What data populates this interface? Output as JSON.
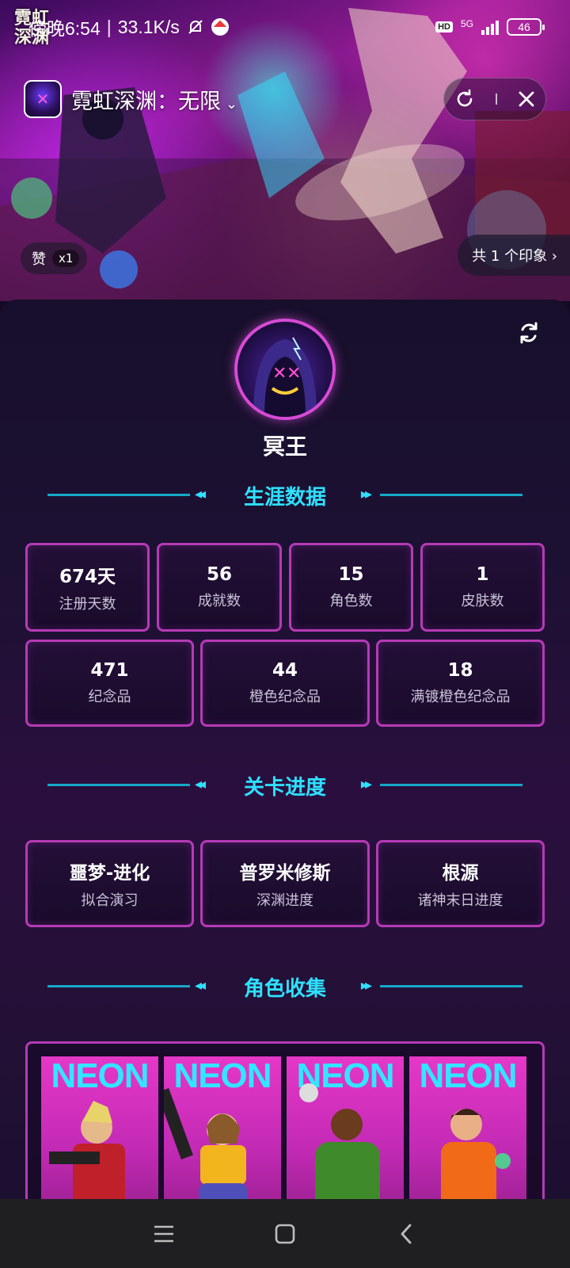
{
  "status_bar": {
    "time": "傍晚6:54",
    "net_speed": "33.1K/s",
    "hd": "HD",
    "network": "5G",
    "battery": "46"
  },
  "mini_program": {
    "title": "霓虹深渊：无限",
    "chevron": "⌄"
  },
  "banner": {
    "logo_top": "霓虹",
    "logo_bottom": "深渊",
    "like_label": "赞",
    "like_count": "x1",
    "impressions": "共 1 个印象 ›"
  },
  "profile": {
    "username": "冥王"
  },
  "sections": {
    "career": "生涯数据",
    "progress": "关卡进度",
    "collection": "角色收集"
  },
  "career_stats_row1": [
    {
      "value": "674天",
      "label": "注册天数"
    },
    {
      "value": "56",
      "label": "成就数"
    },
    {
      "value": "15",
      "label": "角色数"
    },
    {
      "value": "1",
      "label": "皮肤数"
    }
  ],
  "career_stats_row2": [
    {
      "value": "471",
      "label": "纪念品"
    },
    {
      "value": "44",
      "label": "橙色纪念品"
    },
    {
      "value": "18",
      "label": "满镀橙色纪念品"
    }
  ],
  "level_progress": [
    {
      "value": "噩梦-进化",
      "label": "拟合演习"
    },
    {
      "value": "普罗米修斯",
      "label": "深渊进度"
    },
    {
      "value": "根源",
      "label": "诸神末日进度"
    }
  ],
  "characters": [
    {
      "badge": "NEON",
      "shirt": "#c0202a",
      "skin": "#e6b98a"
    },
    {
      "badge": "NEON",
      "shirt": "#f2b51e",
      "skin": "#f0c8a0"
    },
    {
      "badge": "NEON",
      "shirt": "#3f8a2a",
      "skin": "#6a3b1c"
    },
    {
      "badge": "NEON",
      "shirt": "#f06a18",
      "skin": "#e9b088"
    }
  ],
  "colors": {
    "accent_cyan": "#2fe0ff",
    "frame_magenta": "#b63ab6"
  }
}
